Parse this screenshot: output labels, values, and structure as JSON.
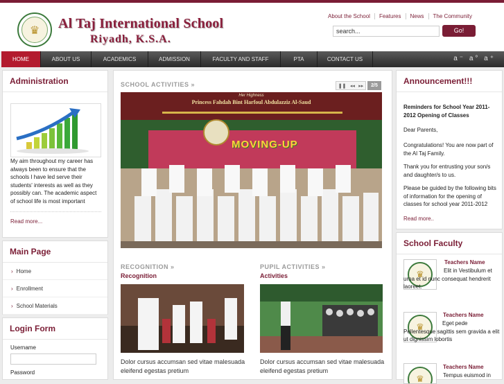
{
  "header": {
    "school_name": "Al Taj International School",
    "school_city": "Riyadh, K.S.A.",
    "top_links": [
      "About the School",
      "Features",
      "News",
      "The Community"
    ],
    "search_value": "search...",
    "go_label": "Go!"
  },
  "nav": {
    "items": [
      "HOME",
      "ABOUT US",
      "ACADEMICS",
      "ADMISSION",
      "FACULTY AND STAFF",
      "PTA",
      "CONTACT US"
    ],
    "font_controls": "a⁻ a° a⁺"
  },
  "administration": {
    "title": "Administration",
    "text": "My aim throughout my career has always been to ensure that the schools I have led serve their students' interests as well as they possibly can. The academic aspect of school life is most important",
    "read_more": "Read more..."
  },
  "main_page": {
    "title": "Main Page",
    "items": [
      "Home",
      "Enrollment",
      "School Materials"
    ]
  },
  "login": {
    "title": "Login Form",
    "username_label": "Username",
    "password_label": "Password"
  },
  "school_activities": {
    "label": "SCHOOL ACTIVITIES »",
    "counter": "2/5",
    "banner_line1": "Her Highness",
    "banner_line2": "Princess Fahdah Bint Harfoul Abdulazziz Al-Saud",
    "banner_sign": "MOVING-UP"
  },
  "recognition": {
    "label": "RECOGNITION »",
    "title": "Recognition",
    "text": "Dolor cursus accumsan sed vitae malesuada eleifend egestas pretium"
  },
  "pupil_activities": {
    "label": "PUPIL ACTIVITIES »",
    "title": "Activities",
    "text": "Dolor cursus accumsan sed vitae malesuada eleifend egestas pretium"
  },
  "announcement": {
    "title": "Announcement!!!",
    "heading": "Reminders for School Year 2011-2012 Opening of Classes",
    "p1": "Dear Parents,",
    "p2": "Congratulations! You are now part of the Al Taj Family.",
    "p3": "Thank you for entrusting your son/s and daughter/s to us.",
    "p4": "Please be guided by the following bits of information for the opening of classes for school year 2011-2012",
    "read_more": "Read more.."
  },
  "faculty": {
    "title": "School Faculty",
    "entries": [
      {
        "name": "Teachers Name",
        "text": "Elit in Vestibulum et urna et id nunc consequat hendrerit laoreet."
      },
      {
        "name": "Teachers Name",
        "text": "Eget pede Pellentesque sagittis sem gravida a elit ut dignissim lobortis"
      },
      {
        "name": "Teachers Name",
        "text": "Tempus euismod in"
      }
    ]
  },
  "colors": {
    "brand": "#7a1d35",
    "nav_active": "#b31b2e"
  }
}
